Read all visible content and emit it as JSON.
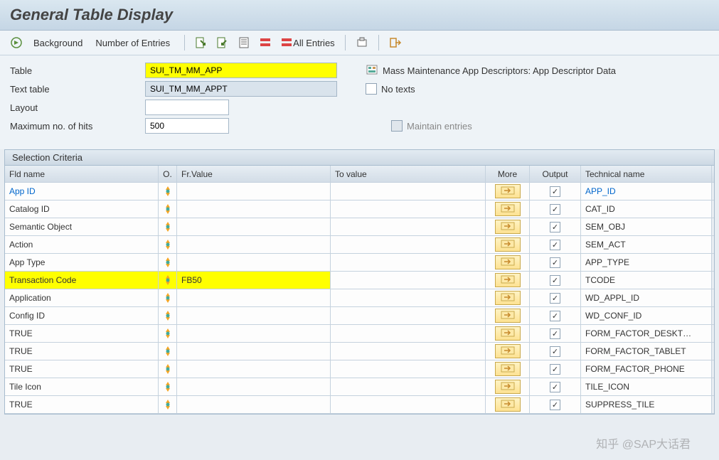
{
  "title": "General Table Display",
  "toolbar": {
    "background": "Background",
    "numEntries": "Number of Entries",
    "allEntries": "All Entries"
  },
  "form": {
    "labels": {
      "table": "Table",
      "textTable": "Text table",
      "layout": "Layout",
      "maxHits": "Maximum no. of hits"
    },
    "values": {
      "table": "SUI_TM_MM_APP",
      "textTable": "SUI_TM_MM_APPT",
      "layout": "",
      "maxHits": "500"
    },
    "rightDesc": "Mass Maintenance App Descriptors: App Descriptor Data",
    "noTexts": "No texts",
    "maintain": "Maintain entries"
  },
  "section": "Selection Criteria",
  "headers": {
    "fld": "Fld name",
    "op": "O.",
    "fr": "Fr.Value",
    "to": "To value",
    "more": "More",
    "out": "Output",
    "tech": "Technical name"
  },
  "rows": [
    {
      "fld": "App ID",
      "fr": "",
      "tech": "APP_ID",
      "link": true,
      "hl": false,
      "checked": true
    },
    {
      "fld": "Catalog ID",
      "fr": "",
      "tech": "CAT_ID",
      "link": false,
      "hl": false,
      "checked": true
    },
    {
      "fld": "Semantic Object",
      "fr": "",
      "tech": "SEM_OBJ",
      "link": false,
      "hl": false,
      "checked": true
    },
    {
      "fld": "Action",
      "fr": "",
      "tech": "SEM_ACT",
      "link": false,
      "hl": false,
      "checked": true
    },
    {
      "fld": "App Type",
      "fr": "",
      "tech": "APP_TYPE",
      "link": false,
      "hl": false,
      "checked": true
    },
    {
      "fld": "Transaction Code",
      "fr": "FB50",
      "tech": "TCODE",
      "link": false,
      "hl": true,
      "checked": true
    },
    {
      "fld": "Application",
      "fr": "",
      "tech": "WD_APPL_ID",
      "link": false,
      "hl": false,
      "checked": true
    },
    {
      "fld": "Config ID",
      "fr": "",
      "tech": "WD_CONF_ID",
      "link": false,
      "hl": false,
      "checked": true
    },
    {
      "fld": "TRUE",
      "fr": "",
      "tech": "FORM_FACTOR_DESKT…",
      "link": false,
      "hl": false,
      "checked": true
    },
    {
      "fld": "TRUE",
      "fr": "",
      "tech": "FORM_FACTOR_TABLET",
      "link": false,
      "hl": false,
      "checked": true
    },
    {
      "fld": "TRUE",
      "fr": "",
      "tech": "FORM_FACTOR_PHONE",
      "link": false,
      "hl": false,
      "checked": true
    },
    {
      "fld": "Tile Icon",
      "fr": "",
      "tech": "TILE_ICON",
      "link": false,
      "hl": false,
      "checked": true
    },
    {
      "fld": "TRUE",
      "fr": "",
      "tech": "SUPPRESS_TILE",
      "link": false,
      "hl": false,
      "checked": true
    }
  ],
  "watermark": "知乎 @SAP大话君"
}
